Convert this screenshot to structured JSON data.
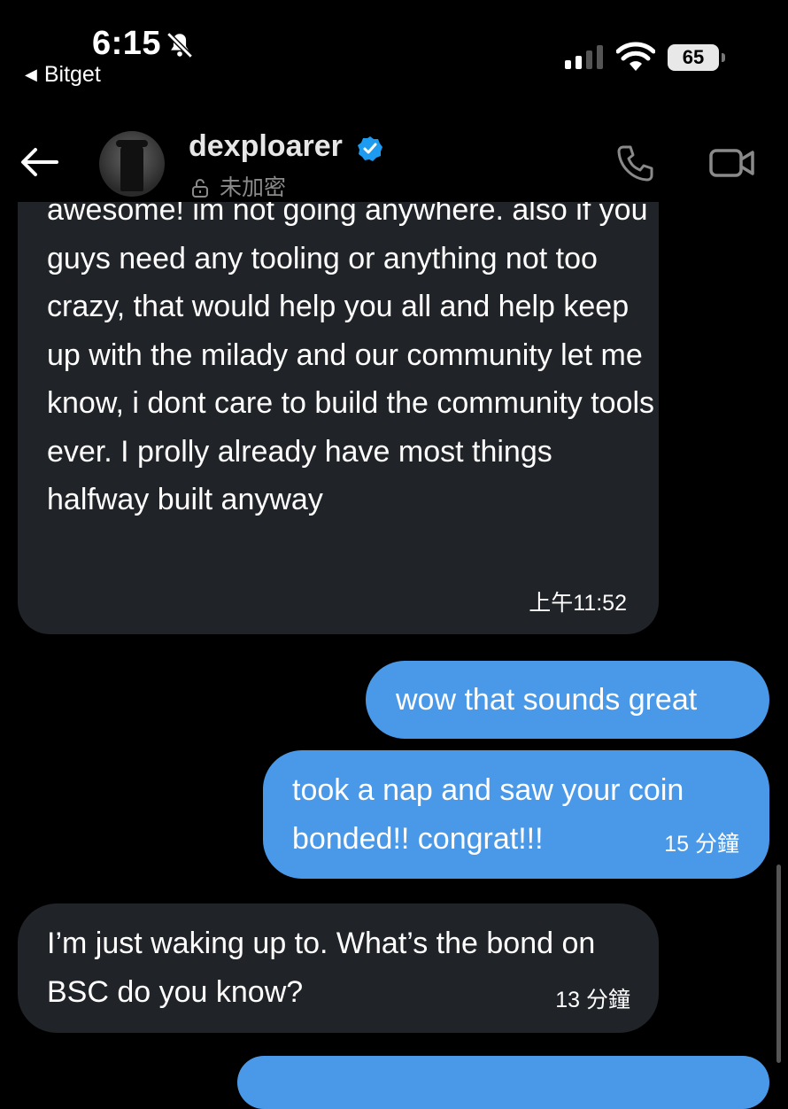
{
  "status_bar": {
    "time": "6:15",
    "back_app": "Bitget",
    "battery": "65"
  },
  "header": {
    "username": "dexploarer",
    "encryption_status": "未加密"
  },
  "messages": [
    {
      "direction": "incoming",
      "text": "awesome! im not going anywhere. also if you guys need any tooling or anything not too crazy, that would help you all and help keep up with the milady and our community let me know, i dont care to build the community tools ever. I prolly already have most things halfway built anyway",
      "time": "上午11:52"
    },
    {
      "direction": "outgoing",
      "text": "wow that sounds great"
    },
    {
      "direction": "outgoing",
      "text": "took a nap and saw your coin bonded!! congrat!!!",
      "time": "15 分鐘"
    },
    {
      "direction": "incoming",
      "text": "I’m just waking up to. What’s the bond on BSC do you know?",
      "time": "13 分鐘"
    }
  ],
  "colors": {
    "background": "#000000",
    "incoming_bubble": "#202327",
    "outgoing_bubble": "#4a99e9",
    "verified_badge": "#1d9bf0"
  },
  "icons": [
    "bell-slash-icon",
    "signal-icon",
    "wifi-icon",
    "back-arrow-icon",
    "verified-badge-icon",
    "lock-open-icon",
    "phone-icon",
    "video-icon"
  ]
}
